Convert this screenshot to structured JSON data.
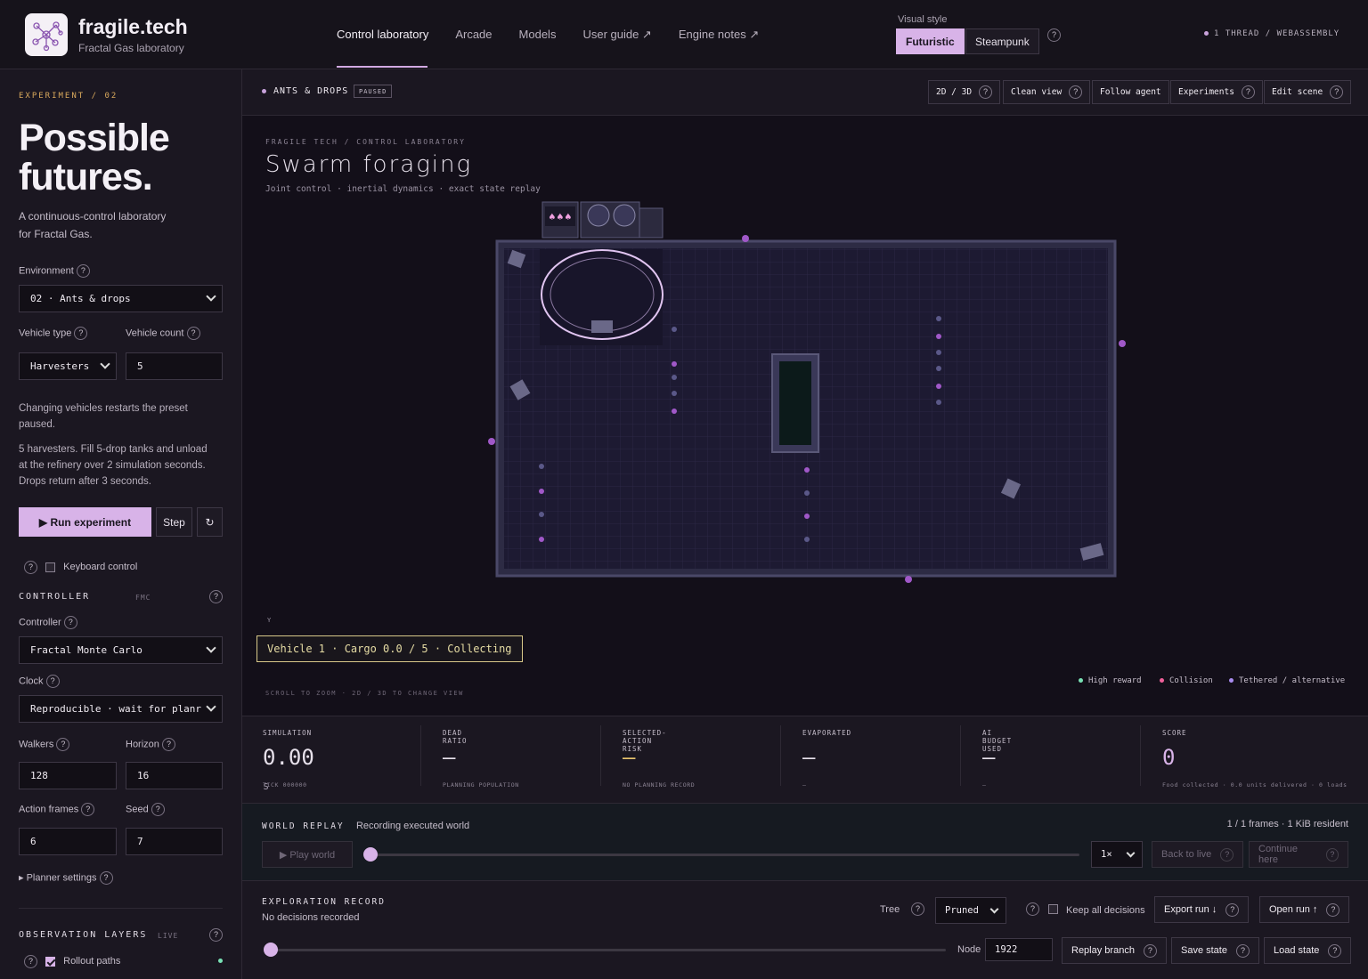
{
  "header": {
    "brand": "fragile.tech",
    "brand_sub": "Fractal Gas laboratory",
    "nav": [
      "Control laboratory",
      "Arcade",
      "Models",
      "User guide ↗",
      "Engine notes ↗"
    ],
    "visual_style_label": "Visual style",
    "styles": [
      "Futuristic",
      "Steampunk"
    ],
    "thread": "1 THREAD / WEBASSEMBLY"
  },
  "sidebar": {
    "eyebrow": "EXPERIMENT / 02",
    "hero_line1": "Possible",
    "hero_line2": "futures.",
    "lead_line1": "A continuous-control laboratory",
    "lead_line2": "for Fractal Gas.",
    "environment_label": "Environment",
    "environment_value": "02 · Ants & drops",
    "vehicle_type_label": "Vehicle type",
    "vehicle_type_value": "Harvesters",
    "vehicle_count_label": "Vehicle count",
    "vehicle_count_value": "5",
    "restart_note_1": "Changing vehicles restarts the preset",
    "restart_note_2": "paused.",
    "desc_1": "5 harvesters. Fill 5-drop tanks and unload",
    "desc_2": "at the refinery over 2 simulation seconds.",
    "desc_3": "Drops return after 3 seconds.",
    "run_label": "▶ Run experiment",
    "step_label": "Step",
    "reset_icon": "↻",
    "keyboard_label": "Keyboard control",
    "controller_heading": "CONTROLLER",
    "controller_tag": "FMC",
    "controller_label": "Controller",
    "controller_value": "Fractal Monte Carlo",
    "clock_label": "Clock",
    "clock_value": "Reproducible · wait for planr",
    "walkers_label": "Walkers",
    "walkers_value": "128",
    "horizon_label": "Horizon",
    "horizon_value": "16",
    "action_frames_label": "Action frames",
    "action_frames_value": "6",
    "seed_label": "Seed",
    "seed_value": "7",
    "planner_settings": "▸ Planner settings",
    "obs_heading": "OBSERVATION LAYERS",
    "obs_tag": "LIVE",
    "rollout_label": "Rollout paths",
    "rollout_checked": true
  },
  "main": {
    "env_name": "ANTS & DROPS",
    "status": "PAUSED",
    "toolbar": [
      "2D / 3D",
      "Clean view",
      "Follow agent",
      "Experiments",
      "Edit scene"
    ],
    "stage": {
      "crumb": "FRAGILE TECH / CONTROL LABORATORY",
      "title": "Swarm foraging",
      "subtitle": "Joint control · inertial dynamics · exact state replay",
      "axis_y": "Y",
      "vehicle_status": "Vehicle 1 · Cargo 0.0 / 5 · Collecting",
      "hint": "SCROLL TO ZOOM · 2D / 3D TO CHANGE VIEW",
      "legend": [
        {
          "label": "High reward",
          "color": "#79e2b5"
        },
        {
          "label": "Collision",
          "color": "#f0609a"
        },
        {
          "label": "Tethered / alternative",
          "color": "#a98cf0"
        }
      ]
    },
    "metrics": [
      {
        "label": "SIMULATION",
        "value": "0.00",
        "unit": "s",
        "sub": "TICK 000000",
        "color": "#e6e0ea"
      },
      {
        "label": "DEAD RATIO",
        "value": "—",
        "unit": "",
        "sub": "PLANNING POPULATION",
        "color": "#e6e0ea"
      },
      {
        "label": "SELECTED-ACTION RISK",
        "value": "—",
        "unit": "",
        "sub": "NO PLANNING RECORD",
        "color": "#e7c36d"
      },
      {
        "label": "EVAPORATED",
        "value": "—",
        "unit": "",
        "sub": "—",
        "color": "#e6e0ea"
      },
      {
        "label": "AI BUDGET USED",
        "value": "—",
        "unit": "",
        "sub": "—",
        "color": "#e6e0ea"
      },
      {
        "label": "SCORE",
        "value": "0",
        "unit": "",
        "sub": "Food collected · 0.0 units delivered · 0 loads",
        "color": "#d8b3e8"
      }
    ],
    "replay": {
      "heading": "WORLD REPLAY",
      "status": "Recording executed world",
      "frames": "1 / 1 frames · 1 KiB resident",
      "play_label": "▶ Play world",
      "speed": "1×",
      "back_label": "Back to live",
      "continue_label": "Continue here",
      "position": 0
    },
    "record": {
      "heading": "EXPLORATION RECORD",
      "status": "No decisions recorded",
      "tree_label": "Tree",
      "tree_value": "Pruned",
      "keep_label": "Keep all decisions",
      "export_label": "Export run ↓",
      "open_label": "Open run ↑",
      "node_label": "Node",
      "node_value": "1922",
      "replay_branch_label": "Replay branch",
      "save_label": "Save state",
      "load_label": "Load state",
      "position": 0
    }
  }
}
